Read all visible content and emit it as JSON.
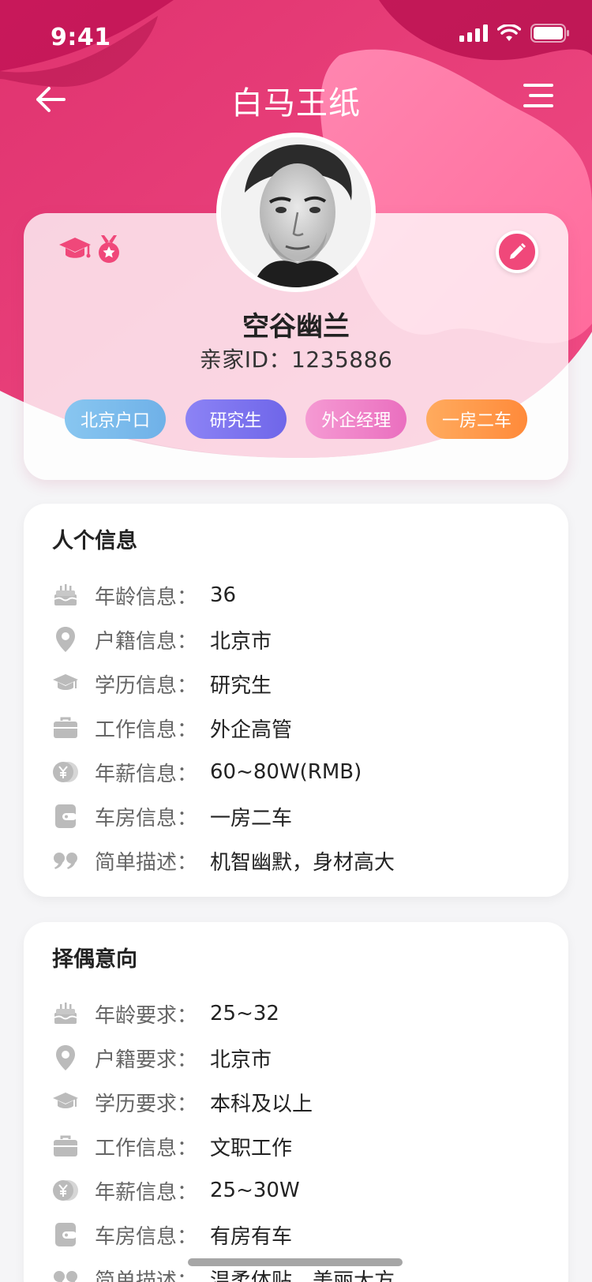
{
  "status_bar": {
    "time": "9:41"
  },
  "nav": {
    "title": "白马王纸",
    "back_icon": "arrow-left-icon",
    "menu_icon": "menu-icon"
  },
  "profile": {
    "name": "空谷幽兰",
    "id_text": "亲家ID：1235886",
    "badges": [
      "graduation-cap-icon",
      "medal-icon"
    ],
    "edit_icon": "pencil-icon",
    "tags": [
      "北京户口",
      "研究生",
      "外企经理",
      "一房二车"
    ]
  },
  "personal_info": {
    "title": "人个信息",
    "rows": [
      {
        "icon": "cake-icon",
        "label": "年龄信息：",
        "value": "36"
      },
      {
        "icon": "location-pin-icon",
        "label": "户籍信息：",
        "value": "北京市"
      },
      {
        "icon": "graduation-cap-icon",
        "label": "学历信息：",
        "value": "研究生"
      },
      {
        "icon": "briefcase-icon",
        "label": "工作信息：",
        "value": "外企高管"
      },
      {
        "icon": "yuan-coin-icon",
        "label": "年薪信息：",
        "value": "60~80W(RMB)"
      },
      {
        "icon": "wallet-icon",
        "label": "车房信息：",
        "value": "一房二车"
      },
      {
        "icon": "quote-icon",
        "label": "简单描述：",
        "value": "机智幽默，身材高大"
      }
    ]
  },
  "partner_preference": {
    "title": "择偶意向",
    "rows": [
      {
        "icon": "cake-icon",
        "label": "年龄要求：",
        "value": "25~32"
      },
      {
        "icon": "location-pin-icon",
        "label": "户籍要求：",
        "value": "北京市"
      },
      {
        "icon": "graduation-cap-icon",
        "label": "学历要求：",
        "value": "本科及以上"
      },
      {
        "icon": "briefcase-icon",
        "label": "工作信息：",
        "value": "文职工作"
      },
      {
        "icon": "yuan-coin-icon",
        "label": "年薪信息：",
        "value": "25~30W"
      },
      {
        "icon": "wallet-icon",
        "label": "车房信息：",
        "value": "有房有车"
      },
      {
        "icon": "quote-icon",
        "label": "简单描述：",
        "value": "温柔体贴，美丽大方"
      }
    ]
  },
  "colors": {
    "brand_pink": "#e53a78",
    "brand_dark": "#c21f5b",
    "accent_light": "#ff7aa8"
  }
}
